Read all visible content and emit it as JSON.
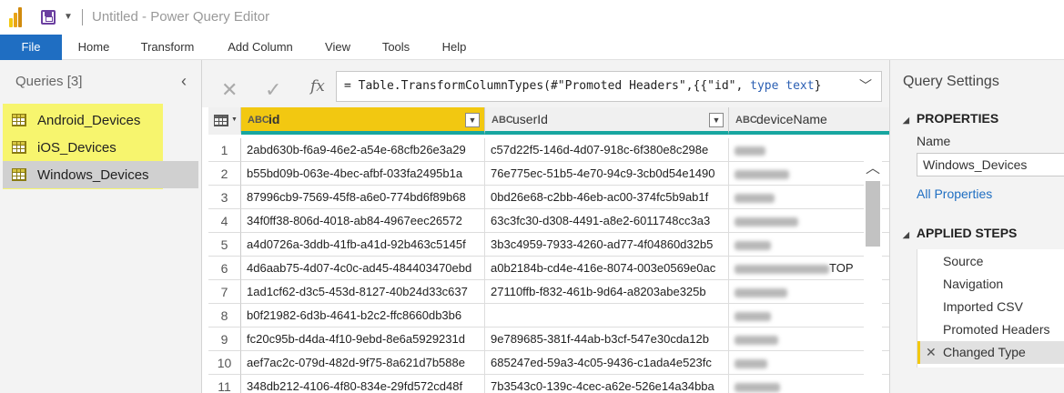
{
  "window": {
    "title": "Untitled - Power Query Editor"
  },
  "ribbon": {
    "tabs": [
      {
        "label": "File"
      },
      {
        "label": "Home"
      },
      {
        "label": "Transform"
      },
      {
        "label": "Add Column"
      },
      {
        "label": "View"
      },
      {
        "label": "Tools"
      },
      {
        "label": "Help"
      }
    ]
  },
  "queries": {
    "title": "Queries [3]",
    "items": [
      {
        "label": "Android_Devices"
      },
      {
        "label": "iOS_Devices"
      },
      {
        "label": "Windows_Devices",
        "selected": true
      }
    ]
  },
  "formula": {
    "prefix": "= Table.TransformColumnTypes(#\"Promoted Headers\",{{\"id\", ",
    "kw": "type text",
    "suffix": "}"
  },
  "grid": {
    "columns": [
      {
        "type": "ABC",
        "name": "id"
      },
      {
        "type": "ABC",
        "name": "userId"
      },
      {
        "type": "ABC",
        "name": "deviceName"
      }
    ],
    "rows": [
      {
        "num": "1",
        "id": "2abd630b-f6a9-46e2-a54e-68cfb26e3a29",
        "userId": "c57d22f5-146d-4d07-918c-6f380e8c298e",
        "deviceName": ""
      },
      {
        "num": "2",
        "id": "b55bd09b-063e-4bec-afbf-033fa2495b1a",
        "userId": "76e775ec-51b5-4e70-94c9-3cb0d54e1490",
        "deviceName": ""
      },
      {
        "num": "3",
        "id": "87996cb9-7569-45f8-a6e0-774bd6f89b68",
        "userId": "0bd26e68-c2bb-46eb-ac00-374fc5b9ab1f",
        "deviceName": ""
      },
      {
        "num": "4",
        "id": "34f0ff38-806d-4018-ab84-4967eec26572",
        "userId": "63c3fc30-d308-4491-a8e2-6011748cc3a3",
        "deviceName": ""
      },
      {
        "num": "5",
        "id": "a4d0726a-3ddb-41fb-a41d-92b463c5145f",
        "userId": "3b3c4959-7933-4260-ad77-4f04860d32b5",
        "deviceName": ""
      },
      {
        "num": "6",
        "id": "4d6aab75-4d07-4c0c-ad45-484403470ebd",
        "userId": "a0b2184b-cd4e-416e-8074-003e0569e0ac",
        "deviceName": "TOP"
      },
      {
        "num": "7",
        "id": "1ad1cf62-d3c5-453d-8127-40b24d33c637",
        "userId": "27110ffb-f832-461b-9d64-a8203abe325b",
        "deviceName": ""
      },
      {
        "num": "8",
        "id": "b0f21982-6d3b-4641-b2c2-ffc8660db3b6",
        "userId": "",
        "deviceName": ""
      },
      {
        "num": "9",
        "id": "fc20c95b-d4da-4f10-9ebd-8e6a5929231d",
        "userId": "9e789685-381f-44ab-b3cf-547e30cda12b",
        "deviceName": ""
      },
      {
        "num": "10",
        "id": "aef7ac2c-079d-482d-9f75-8a621d7b588e",
        "userId": "685247ed-59a3-4c05-9436-c1ada4e523fc",
        "deviceName": ""
      },
      {
        "num": "11",
        "id": "348db212-4106-4f80-834e-29fd572cd48f",
        "userId": "7b3543c0-139c-4cec-a62e-526e14a34bba",
        "deviceName": ""
      }
    ]
  },
  "settings": {
    "title": "Query Settings",
    "properties_head": "PROPERTIES",
    "name_label": "Name",
    "name_value": "Windows_Devices",
    "all_properties": "All Properties",
    "steps_head": "APPLIED STEPS",
    "steps": [
      {
        "label": "Source"
      },
      {
        "label": "Navigation"
      },
      {
        "label": "Imported CSV"
      },
      {
        "label": "Promoted Headers"
      },
      {
        "label": "Changed Type",
        "active": true
      }
    ]
  }
}
